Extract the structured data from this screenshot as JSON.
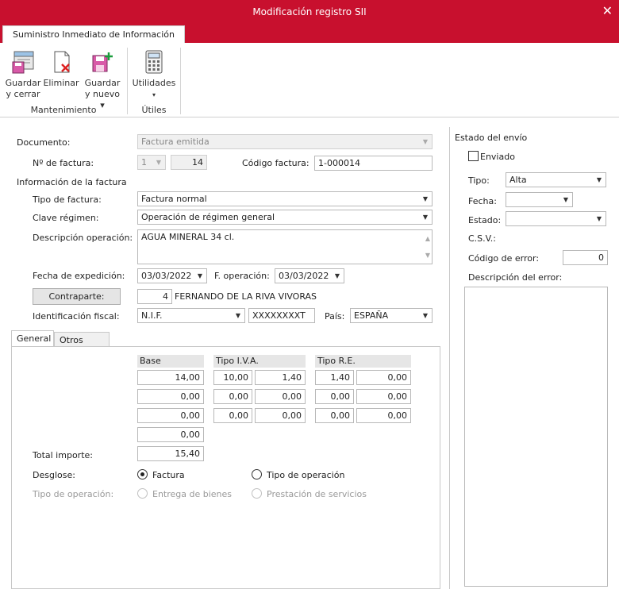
{
  "window": {
    "title": "Modificación registro SII",
    "close_icon": "✕"
  },
  "ribbon": {
    "tab": "Suministro Inmediato de Información",
    "save_close": {
      "line1": "Guardar",
      "line2": "y cerrar"
    },
    "delete": "Eliminar",
    "save_new": {
      "line1": "Guardar",
      "line2": "y nuevo ▾"
    },
    "utilities": "Utilidades",
    "utilities_arrow": "▾",
    "group_mant": "Mantenimiento",
    "group_util": "Útiles"
  },
  "form": {
    "documento_label": "Documento:",
    "documento_value": "Factura emitida",
    "nfactura_label": "Nº de factura:",
    "serie_value": "1",
    "nfactura_value": "14",
    "codigo_label": "Código factura:",
    "codigo_value": "1-000014",
    "info_label": "Información de la factura",
    "tipo_factura_label": "Tipo de factura:",
    "tipo_factura_value": "Factura normal",
    "clave_label": "Clave régimen:",
    "clave_value": "Operación de régimen general",
    "desc_label": "Descripción operación:",
    "desc_value": "AGUA MINERAL 34 cl.",
    "fexp_label": "Fecha de expedición:",
    "fexp_value": "03/03/2022",
    "fop_label": "F. operación:",
    "fop_value": "03/03/2022",
    "contraparte_button": "Contraparte:",
    "contraparte_num": "4",
    "contraparte_name": "FERNANDO DE LA RIVA VIVORAS",
    "idfiscal_label": "Identificación fiscal:",
    "idfiscal_type": "N.I.F.",
    "idfiscal_value": "XXXXXXXXT",
    "pais_label": "País:",
    "pais_value": "ESPAÑA"
  },
  "tabs": {
    "general": "General",
    "otros": "Otros datos"
  },
  "general": {
    "hdr_base": "Base",
    "hdr_iva": "Tipo I.V.A.",
    "hdr_re": "Tipo R.E.",
    "rows": [
      {
        "base": "14,00",
        "iva_pct": "10,00",
        "iva_amt": "1,40",
        "re_pct": "1,40",
        "re_amt": "0,00"
      },
      {
        "base": "0,00",
        "iva_pct": "0,00",
        "iva_amt": "0,00",
        "re_pct": "0,00",
        "re_amt": "0,00"
      },
      {
        "base": "0,00",
        "iva_pct": "0,00",
        "iva_amt": "0,00",
        "re_pct": "0,00",
        "re_amt": "0,00"
      }
    ],
    "extra_base": "0,00",
    "total_label": "Total importe:",
    "total_value": "15,40",
    "desglose_label": "Desglose:",
    "opt_factura": "Factura",
    "opt_tipo_op": "Tipo de operación",
    "tipo_op_label": "Tipo de operación:",
    "opt_entrega": "Entrega de bienes",
    "opt_prestacion": "Prestación de servicios"
  },
  "estado": {
    "title": "Estado del envío",
    "enviado": "Enviado",
    "tipo_label": "Tipo:",
    "tipo_value": "Alta",
    "fecha_label": "Fecha:",
    "fecha_value": "",
    "estado_label": "Estado:",
    "estado_value": "",
    "csv_label": "C.S.V.:",
    "codigo_error_label": "Código de error:",
    "codigo_error_value": "0",
    "desc_error_label": "Descripción del error:"
  },
  "colors": {
    "accent": "#c8102e"
  }
}
